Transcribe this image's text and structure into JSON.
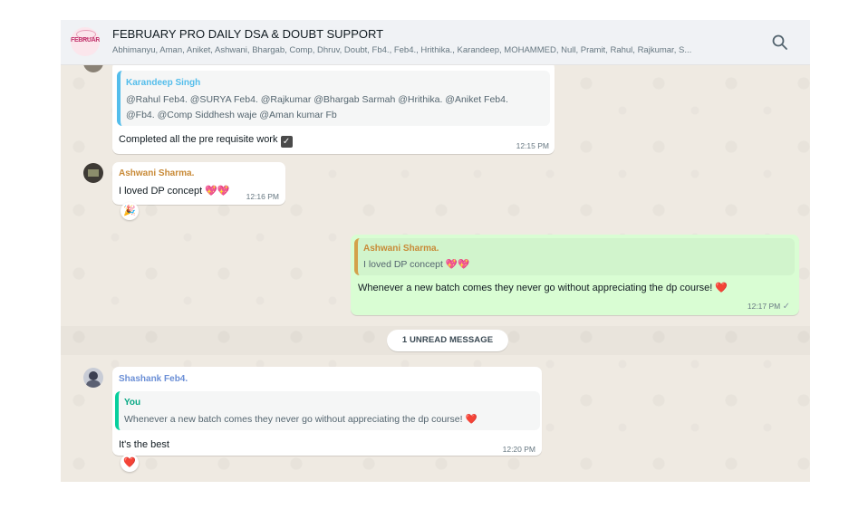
{
  "header": {
    "group_logo_text": "FEBRUARY",
    "title": "FEBRUARY PRO DAILY DSA & DOUBT SUPPORT",
    "members": "Abhimanyu, Aman, Aniket, Ashwani, Bhargab, Comp, Dhruv, Doubt, Fb4., Feb4., Hrithika., Karandeep, MOHAMMED, Null, Pramit, Rahul, Rajkumar, S...",
    "search_icon": "search-icon"
  },
  "messages": [
    {
      "direction": "incoming",
      "quote": {
        "name": "Karandeep Singh",
        "line1": "@Rahul Feb4. @SURYA Feb4. @Rajkumar @Bhargab Sarmah @Hrithika. @Aniket Feb4.",
        "line2": "@Fb4. @Comp Siddhesh waje @Aman kumar Fb",
        "name_color": "#53bdeb"
      },
      "text": "Completed all the pre requisite work",
      "emoji": "check-box-icon",
      "time": "12:15 PM"
    },
    {
      "direction": "incoming",
      "sender": "Ashwani Sharma.",
      "sender_color": "#c88a37",
      "text": "I loved DP concept",
      "emoji": "💖💖",
      "time": "12:16 PM",
      "reaction": "🎉"
    },
    {
      "direction": "outgoing",
      "quote": {
        "name": "Ashwani Sharma.",
        "text": "I loved DP concept",
        "emoji": "💖💖",
        "name_color": "#c88a37"
      },
      "text": "Whenever a new batch comes they never go without appreciating the dp course!",
      "emoji": "❤️",
      "time": "12:17 PM",
      "status": "✓"
    },
    {
      "direction": "incoming",
      "sender": "Shashank Feb4.",
      "sender_color": "#6b8fd6",
      "quote": {
        "name": "You",
        "text": "Whenever a new batch comes they never go without appreciating the dp course!",
        "emoji": "❤️",
        "name_color": "#06a884"
      },
      "text": "It's the best",
      "time": "12:20 PM",
      "reaction": "❤️"
    }
  ],
  "unread_label": "1 UNREAD MESSAGE"
}
